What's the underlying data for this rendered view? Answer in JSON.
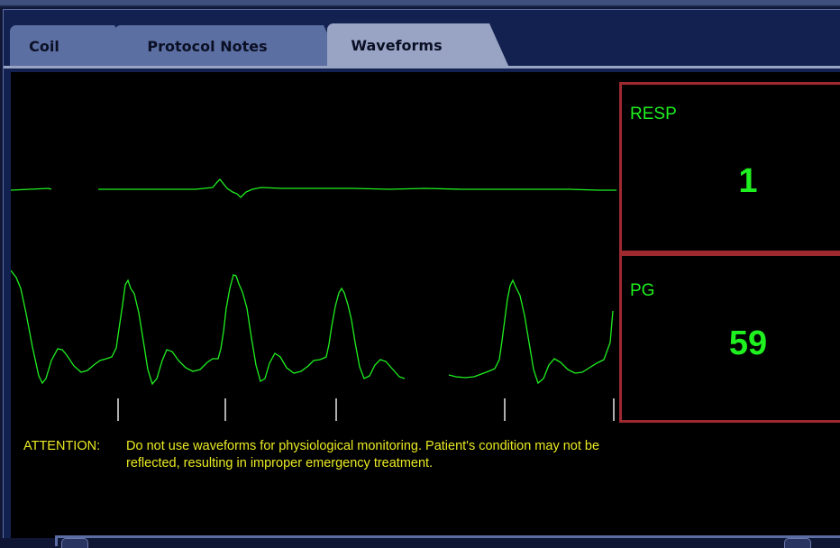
{
  "tabs": [
    {
      "label": "Coil",
      "active": false
    },
    {
      "label": "Protocol Notes",
      "active": false
    },
    {
      "label": "Waveforms",
      "active": true
    }
  ],
  "readouts": {
    "resp": {
      "label": "RESP",
      "value": "1"
    },
    "pg": {
      "label": "PG",
      "value": "59"
    }
  },
  "attention": {
    "prefix": "ATTENTION:",
    "line1": "Do not use waveforms for physiological monitoring. Patient's condition may not be",
    "line2": "reflected, resulting in improper emergency treatment."
  },
  "colors": {
    "trace": "#1ff01f",
    "readout_border": "#9e2a30",
    "attention_text": "#eaea24",
    "tab_active": "#99a4c4",
    "tab_inactive": "#5c6fa2"
  }
}
